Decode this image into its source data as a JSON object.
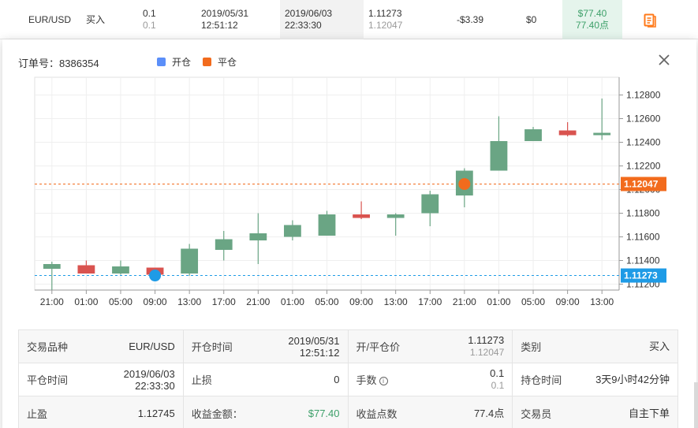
{
  "trade_row": {
    "symbol": "EUR/USD",
    "direction": "买入",
    "lots": "0.1",
    "lots_sub": "0.1",
    "open_date": "2019/05/31",
    "open_time": "12:51:12",
    "close_date": "2019/06/03",
    "close_time": "22:33:30",
    "open_price": "1.11273",
    "close_price": "1.12047",
    "swap": "-$3.39",
    "commission": "$0",
    "profit": "$77.40",
    "profit_points": "77.40点",
    "accent_color": "#ff7a1a"
  },
  "popup": {
    "order_label": "订单号：8386354",
    "legend": [
      {
        "label": "开仓",
        "color": "#5b8ff9"
      },
      {
        "label": "平仓",
        "color": "#f26b1d"
      }
    ],
    "close_icon": "close-icon"
  },
  "chart_data": {
    "type": "candlestick",
    "categories": [
      "21:00",
      "01:00",
      "05:00",
      "09:00",
      "13:00",
      "17:00",
      "21:00",
      "01:00",
      "05:00",
      "09:00",
      "13:00",
      "17:00",
      "21:00",
      "01:00",
      "05:00",
      "09:00",
      "13:00"
    ],
    "candles": [
      {
        "o": 1.1133,
        "h": 1.1139,
        "l": 1.1115,
        "c": 1.1137
      },
      {
        "o": 1.1136,
        "h": 1.114,
        "l": 1.1129,
        "c": 1.1129
      },
      {
        "o": 1.1129,
        "h": 1.114,
        "l": 1.1128,
        "c": 1.1135
      },
      {
        "o": 1.1134,
        "h": 1.1134,
        "l": 1.1127,
        "c": 1.1128
      },
      {
        "o": 1.1129,
        "h": 1.1154,
        "l": 1.1127,
        "c": 1.115
      },
      {
        "o": 1.1149,
        "h": 1.1165,
        "l": 1.114,
        "c": 1.1158
      },
      {
        "o": 1.1157,
        "h": 1.118,
        "l": 1.1137,
        "c": 1.1163
      },
      {
        "o": 1.116,
        "h": 1.1174,
        "l": 1.1157,
        "c": 1.117
      },
      {
        "o": 1.1161,
        "h": 1.1182,
        "l": 1.1161,
        "c": 1.1179
      },
      {
        "o": 1.1179,
        "h": 1.119,
        "l": 1.1175,
        "c": 1.1176
      },
      {
        "o": 1.1176,
        "h": 1.118,
        "l": 1.1161,
        "c": 1.1179
      },
      {
        "o": 1.118,
        "h": 1.1199,
        "l": 1.1169,
        "c": 1.1196
      },
      {
        "o": 1.1195,
        "h": 1.1218,
        "l": 1.1185,
        "c": 1.1216
      },
      {
        "o": 1.1216,
        "h": 1.1262,
        "l": 1.1216,
        "c": 1.1241
      },
      {
        "o": 1.1241,
        "h": 1.1253,
        "l": 1.1241,
        "c": 1.1251
      },
      {
        "o": 1.125,
        "h": 1.1257,
        "l": 1.1245,
        "c": 1.1246
      },
      {
        "o": 1.1246,
        "h": 1.1277,
        "l": 1.1242,
        "c": 1.1248
      }
    ],
    "y_ticks": [
      "1.12800",
      "1.12600",
      "1.12400",
      "1.12200",
      "1.12000",
      "1.11800",
      "1.11600",
      "1.11400",
      "1.11200"
    ],
    "ylim": [
      1.1115,
      1.1295
    ],
    "open_line": {
      "value": 1.11273,
      "label": "1.11273",
      "color": "#1e9be6"
    },
    "close_line": {
      "value": 1.12047,
      "label": "1.12047",
      "color": "#f26b1d"
    },
    "open_marker": {
      "index": 3,
      "value": 1.11273,
      "color": "#1e9be6"
    },
    "close_marker": {
      "index": 12,
      "value": 1.12047,
      "color": "#f26b1d"
    },
    "up_color": "#6aa584",
    "down_color": "#d9534f",
    "grid": true
  },
  "info": {
    "symbol_label": "交易品种",
    "symbol_value": "EUR/USD",
    "open_time_label": "开仓时间",
    "open_time_date": "2019/05/31",
    "open_time_time": "12:51:12",
    "price_label": "开/平仓价",
    "price_open": "1.11273",
    "price_close": "1.12047",
    "type_label": "类别",
    "type_value": "买入",
    "close_time_label": "平仓时间",
    "close_time_date": "2019/06/03",
    "close_time_time": "22:33:30",
    "sl_label": "止损",
    "sl_value": "0",
    "lots_label": "手数",
    "lots_value": "0.1",
    "lots_sub": "0.1",
    "hold_label": "持仓时间",
    "hold_value": "3天9小时42分钟",
    "tp_label": "止盈",
    "tp_value": "1.12745",
    "profit_label": "收益金额：",
    "profit_value": "$77.40",
    "points_label": "收益点数",
    "points_value": "77.4点",
    "trader_label": "交易员",
    "trader_value": "自主下单"
  }
}
